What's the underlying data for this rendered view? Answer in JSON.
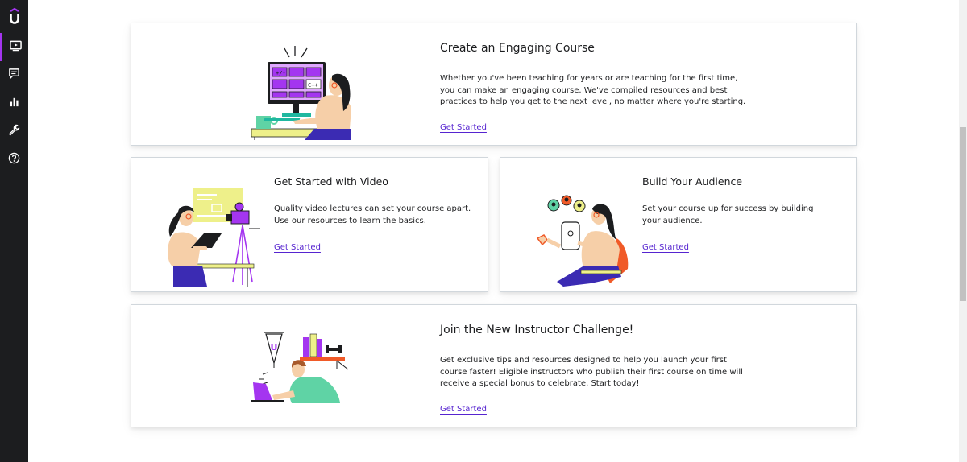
{
  "sidebar": {
    "logo": "U",
    "items": [
      {
        "name": "courses",
        "icon": "video-player-icon",
        "active": true
      },
      {
        "name": "communication",
        "icon": "chat-icon",
        "active": false
      },
      {
        "name": "performance",
        "icon": "bar-chart-icon",
        "active": false
      },
      {
        "name": "tools",
        "icon": "wrench-icon",
        "active": false
      },
      {
        "name": "resources",
        "icon": "help-icon",
        "active": false
      }
    ]
  },
  "cards": {
    "engaging": {
      "title": "Create an Engaging Course",
      "body": "Whether you've been teaching for years or are teaching for the first time, you can make an engaging course. We've compiled resources and best practices to help you get to the next level, no matter where you're starting.",
      "link": "Get Started",
      "screen_tiles": [
        "+/-",
        "",
        "",
        "",
        "",
        "C++"
      ]
    },
    "video": {
      "title": "Get Started with Video",
      "body": "Quality video lectures can set your course apart. Use our resources to learn the basics.",
      "link": "Get Started"
    },
    "audience": {
      "title": "Build Your Audience",
      "body": "Set your course up for success by building your audience.",
      "link": "Get Started"
    },
    "challenge": {
      "title": "Join the New Instructor Challenge!",
      "body": "Get exclusive tips and resources designed to help you launch your first course faster! Eligible instructors who publish their first course on time will receive a special bonus to celebrate. Start today!",
      "link": "Get Started",
      "pennant_letter": "U"
    }
  },
  "colors": {
    "brand_purple": "#a435f0",
    "link_purple": "#5624d0",
    "sidebar_bg": "#1c1d1f",
    "skin": "#f6cfa8",
    "navy": "#3b2bb3",
    "mint": "#5fd3a5",
    "yellow": "#eef08a",
    "orange": "#f05a28"
  }
}
